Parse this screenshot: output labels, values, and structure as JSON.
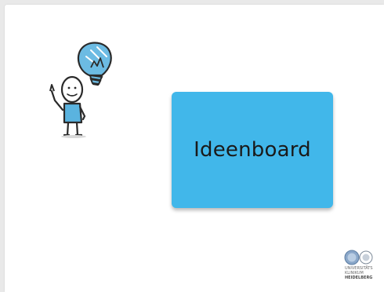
{
  "slide": {
    "title": "Ideenboard",
    "card_color": "#41b7ea",
    "accent_color": "#5ab3df"
  },
  "logo": {
    "line1": "UNIVERSITÄTS",
    "line2": "KLINIKUM",
    "line3": "HEIDELBERG"
  },
  "icons": {
    "illustration": "stick-figure-with-lightbulb-icon",
    "logo_seals": "university-seal-icon"
  }
}
